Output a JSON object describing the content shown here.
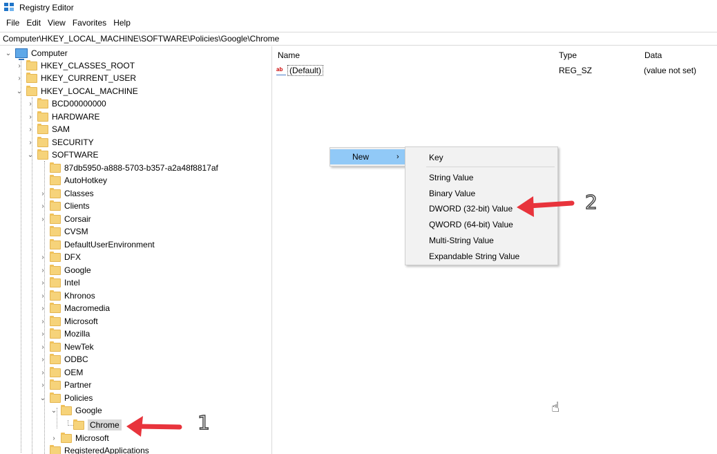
{
  "window": {
    "title": "Registry Editor",
    "accent_color": "#1e74c8"
  },
  "menubar": [
    "File",
    "Edit",
    "View",
    "Favorites",
    "Help"
  ],
  "address": "Computer\\HKEY_LOCAL_MACHINE\\SOFTWARE\\Policies\\Google\\Chrome",
  "tree": {
    "root": "Computer",
    "hives": [
      "HKEY_CLASSES_ROOT",
      "HKEY_CURRENT_USER",
      "HKEY_LOCAL_MACHINE"
    ],
    "hklm_children": [
      "BCD00000000",
      "HARDWARE",
      "SAM",
      "SECURITY",
      "SOFTWARE"
    ],
    "software_children": [
      "87db5950-a888-5703-b357-a2a48f8817af",
      "AutoHotkey",
      "Classes",
      "Clients",
      "Corsair",
      "CVSM",
      "DefaultUserEnvironment",
      "DFX",
      "Google",
      "Intel",
      "Khronos",
      "Macromedia",
      "Microsoft",
      "Mozilla",
      "NewTek",
      "ODBC",
      "OEM",
      "Partner",
      "Policies"
    ],
    "policies_children": [
      "Google",
      "Microsoft"
    ],
    "google_children": [
      "Chrome"
    ],
    "after_policies": [
      "RegisteredApplications"
    ]
  },
  "list": {
    "columns": [
      "Name",
      "Type",
      "Data"
    ],
    "rows": [
      {
        "name": "(Default)",
        "type": "REG_SZ",
        "data": "(value not set)"
      }
    ]
  },
  "context_menu": {
    "item": "New",
    "submenu": [
      "Key",
      "String Value",
      "Binary Value",
      "DWORD (32-bit) Value",
      "QWORD (64-bit) Value",
      "Multi-String Value",
      "Expandable String Value"
    ],
    "highlight_color": "#91c9f7"
  },
  "annotations": {
    "step1": "1",
    "step2": "2",
    "arrow_color": "#e8343c"
  }
}
